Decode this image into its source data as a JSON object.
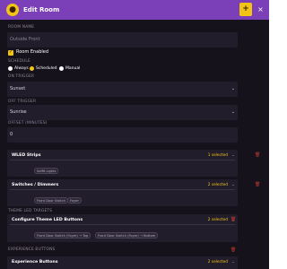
{
  "header": {
    "title": "Edit Room",
    "icon": "lightbulb-icon",
    "add_label": "+",
    "close_label": "×"
  },
  "room_name": {
    "label": "ROOM NAME",
    "value": "Outside Front"
  },
  "room_enabled": {
    "label": "Room Enabled",
    "checked": true
  },
  "schedule": {
    "label": "SCHEDULE",
    "options": [
      {
        "label": "Always",
        "selected": false
      },
      {
        "label": "Scheduled",
        "selected": true
      },
      {
        "label": "Manual",
        "selected": false
      }
    ]
  },
  "on_trigger": {
    "label": "ON TRIGGER",
    "value": "Sunset"
  },
  "off_trigger": {
    "label": "OFF TRIGGER",
    "value": "Sunrise"
  },
  "offset": {
    "label": "OFFSET (MINUTES)",
    "value": "0"
  },
  "wled": {
    "title": "WLED Strips",
    "count": "1 selected",
    "chips": [
      "Soffit Lights"
    ]
  },
  "switches": {
    "title": "Switches / Dimmers",
    "count": "2 selected",
    "chips": [
      "Front Door Switch",
      "Foyer"
    ]
  },
  "theme_led": {
    "label": "THEME LED TARGETS",
    "title": "Configure Theme LED Buttons",
    "count": "2 selected",
    "chips": [
      "Front Door Switch (Foyer) → Top",
      "Front Door Switch (Foyer) → Bottom"
    ]
  },
  "experience": {
    "label": "EXPERIENCE BUTTONS",
    "title": "Experience Buttons",
    "count": "2 selected"
  },
  "colors": {
    "header": "#7b3fb8",
    "accent": "#f2c514",
    "background": "#16121c",
    "field": "#221d2b",
    "danger": "#c0392b"
  }
}
